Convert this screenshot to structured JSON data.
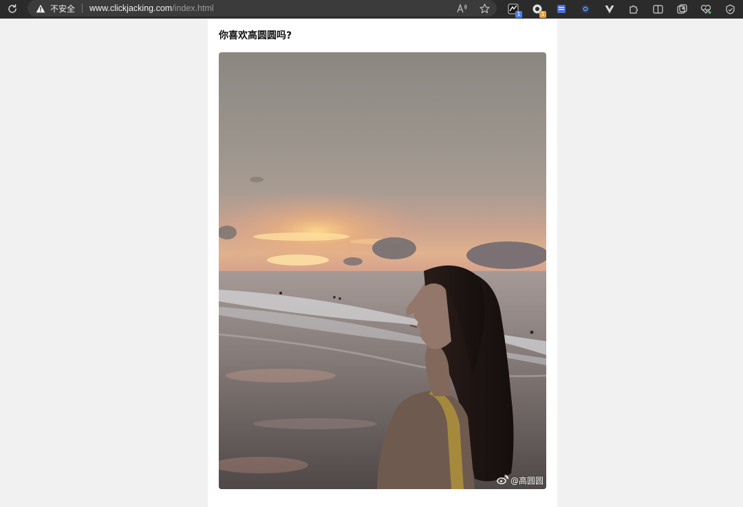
{
  "browser": {
    "security_label": "不安全",
    "url_host": "www.clickjacking.com",
    "url_path": "/index.html",
    "extensions": [
      {
        "icon": "extension-dark-icon",
        "badge": "1",
        "badge_color": "#4a7ff0"
      },
      {
        "icon": "extension-cookie-icon",
        "badge": "1",
        "badge_color": "#e6a23c"
      },
      {
        "icon": "extension-notes-icon"
      },
      {
        "icon": "extension-globe-icon"
      },
      {
        "icon": "extension-vue-icon"
      },
      {
        "icon": "extensions-puzzle-icon"
      },
      {
        "icon": "split-screen-icon"
      },
      {
        "icon": "collections-icon"
      },
      {
        "icon": "performance-heart-icon"
      },
      {
        "icon": "browser-essentials-icon"
      }
    ]
  },
  "page": {
    "question": "你喜欢高圆圆吗?",
    "photo": {
      "subject": "woman on beach at sunset",
      "watermark": "@高圆圆"
    }
  }
}
